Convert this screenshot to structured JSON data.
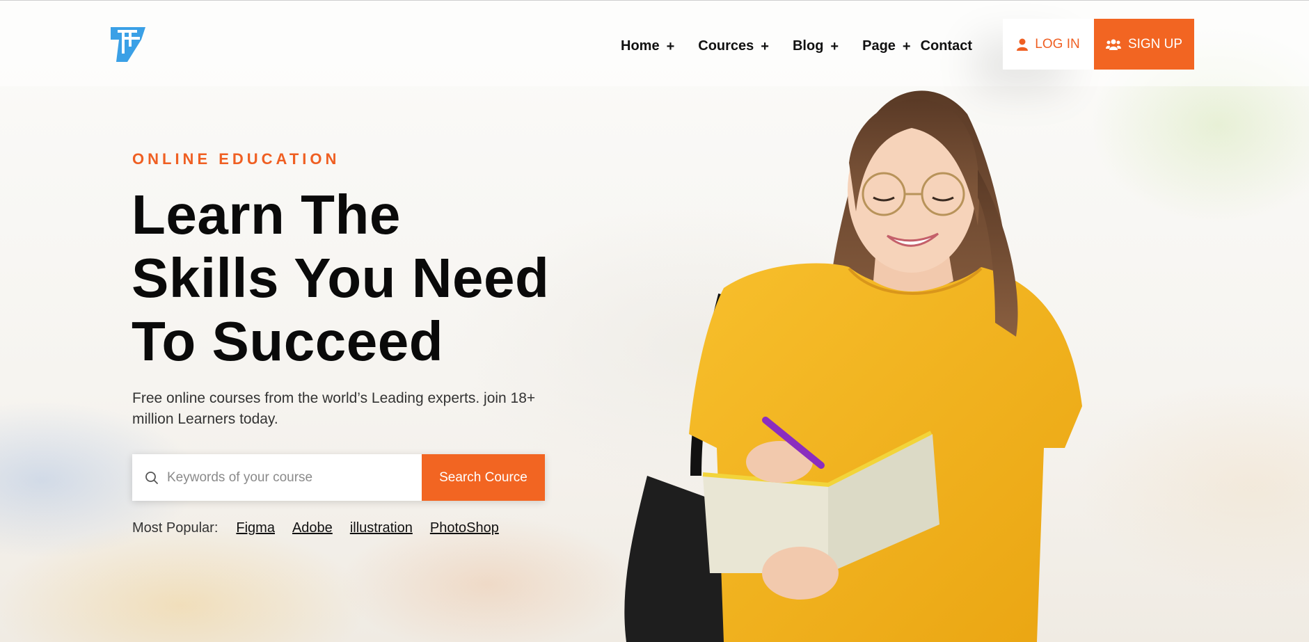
{
  "brand": {
    "logo_icon": "logo-mark-icon",
    "accent": "#f26522",
    "logo_color": "#3aa0e6"
  },
  "nav": {
    "items": [
      {
        "label": "Home",
        "has_submenu": true
      },
      {
        "label": "Cources",
        "has_submenu": true
      },
      {
        "label": "Blog",
        "has_submenu": true
      },
      {
        "label": "Page",
        "has_submenu": true
      },
      {
        "label": "Contact",
        "has_submenu": false
      }
    ],
    "submenu_glyph": "+"
  },
  "auth": {
    "login_label": "LOG IN",
    "signup_label": "SIGN UP",
    "login_icon": "user-icon",
    "signup_icon": "users-icon"
  },
  "hero": {
    "eyebrow": "ONLINE EDUCATION",
    "headline": [
      "Learn The",
      "Skills You Need",
      "To Succeed"
    ],
    "subtext": "Free online courses from the world’s Leading experts. join 18+ million Learners today.",
    "search": {
      "placeholder": "Keywords of your course",
      "value": "",
      "button_label": "Search Cource",
      "icon": "search-icon"
    },
    "popular": {
      "label": "Most Popular:",
      "tags": [
        "Figma",
        "Adobe",
        "illustration",
        "PhotoShop"
      ]
    }
  },
  "image": {
    "subject": "student-writing-in-notebook",
    "shirt_color": "#f5b41f"
  }
}
